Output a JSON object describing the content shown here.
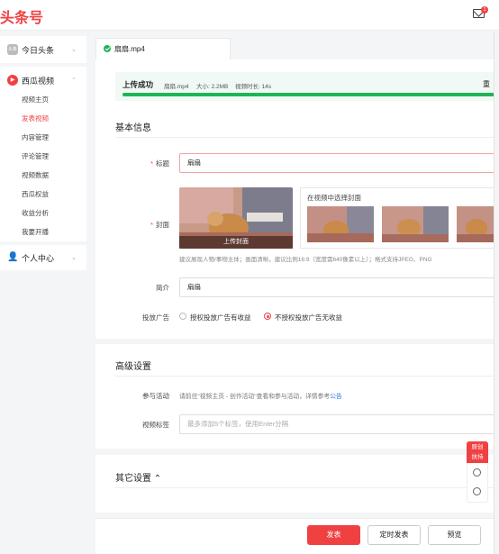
{
  "header": {
    "logo": "头条号",
    "mail_badge": "1"
  },
  "sidebar": {
    "toutiao": {
      "icon": "toutiao-icon",
      "label": "今日头条",
      "icon_text": "头条"
    },
    "xigua": {
      "label": "西瓜视频",
      "items": [
        {
          "label": "视频主页"
        },
        {
          "label": "发表视频"
        },
        {
          "label": "内容管理"
        },
        {
          "label": "评论管理"
        },
        {
          "label": "视频数据"
        },
        {
          "label": "西瓜权益"
        },
        {
          "label": "收益分析"
        },
        {
          "label": "我要开播"
        }
      ]
    },
    "personal": {
      "label": "个人中心"
    }
  },
  "tab": {
    "filename": "扇扇.mp4"
  },
  "upload": {
    "status": "上传成功",
    "file": "扇扇.mp4",
    "size": "大小: 2.2MB",
    "duration": "视频时长: 14s",
    "right": "重",
    "progress": 1.0
  },
  "basic": {
    "section": "基本信息",
    "title_label": "标题",
    "title_value": "扇扇",
    "cover_label": "封面",
    "cover_caption": "上传封面",
    "pick_title": "在视频中选择封面",
    "cover_hint": "建议展现人物/事物主体；画面清晰，建议比例16:9（宽度需640像素以上）；格式支持JPEG、PNG",
    "intro_label": "简介",
    "intro_value": "扇扇",
    "ad_label": "投放广告",
    "ad_option1": "授权投放广告有收益",
    "ad_option2": "不授权投放广告无收益"
  },
  "advanced": {
    "section": "高级设置",
    "activity_label": "参与活动",
    "activity_text": "请前往\"视频主页 - 创作活动\"查看和参与活动，详情参考",
    "activity_link": "公告",
    "tags_label": "视频标签",
    "tags_placeholder": "最多添加5个标签，使用Enter分隔"
  },
  "other": {
    "section": "其它设置"
  },
  "float": {
    "badge_line1": "原创",
    "badge_line2": "扶持"
  },
  "actions": {
    "publish": "发表",
    "schedule": "定时发表",
    "preview": "预览"
  },
  "colors": {
    "accent": "#f04142",
    "success": "#21b35a",
    "link": "#2a7ae2"
  }
}
